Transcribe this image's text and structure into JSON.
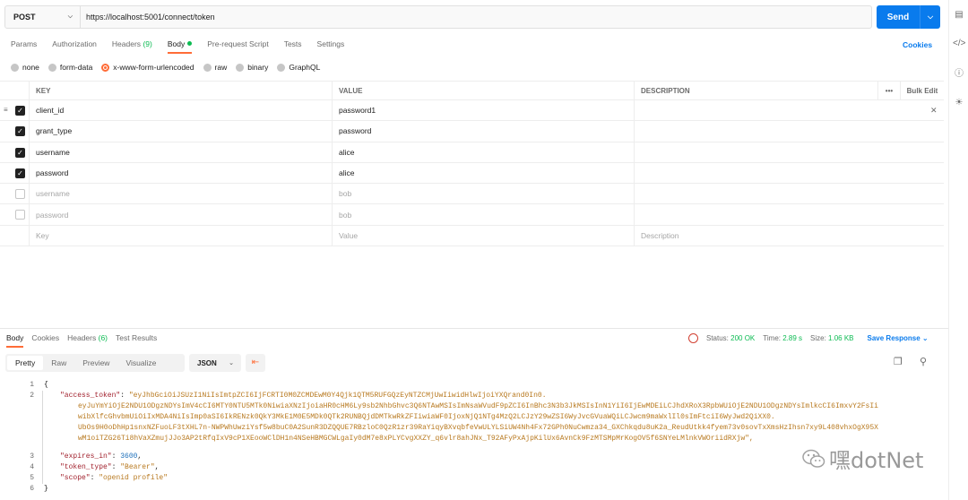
{
  "request": {
    "method": "POST",
    "url": "https://localhost:5001/connect/token",
    "send_label": "Send"
  },
  "tabs": [
    {
      "label": "Params"
    },
    {
      "label": "Authorization"
    },
    {
      "label": "Headers",
      "count": "(9)"
    },
    {
      "label": "Body",
      "active": true
    },
    {
      "label": "Pre-request Script"
    },
    {
      "label": "Tests"
    },
    {
      "label": "Settings"
    }
  ],
  "cookies_label": "Cookies",
  "body_types": [
    "none",
    "form-data",
    "x-www-form-urlencoded",
    "raw",
    "binary",
    "GraphQL"
  ],
  "selected_body_type": "x-www-form-urlencoded",
  "table": {
    "headers": {
      "key": "KEY",
      "value": "VALUE",
      "description": "DESCRIPTION",
      "more": "•••",
      "bulk": "Bulk Edit"
    },
    "rows": [
      {
        "checked": true,
        "key": "client_id",
        "value": "password1"
      },
      {
        "checked": true,
        "key": "grant_type",
        "value": "password"
      },
      {
        "checked": true,
        "key": "username",
        "value": "alice"
      },
      {
        "checked": true,
        "key": "password",
        "value": "alice"
      },
      {
        "checked": false,
        "key": "username",
        "value": "bob"
      },
      {
        "checked": false,
        "key": "password",
        "value": "bob"
      }
    ],
    "placeholder": {
      "key": "Key",
      "value": "Value",
      "description": "Description"
    }
  },
  "response": {
    "tabs": [
      {
        "label": "Body",
        "active": true
      },
      {
        "label": "Cookies"
      },
      {
        "label": "Headers",
        "count": "(6)"
      },
      {
        "label": "Test Results"
      }
    ],
    "status_label": "Status:",
    "status_value": "200 OK",
    "time_label": "Time:",
    "time_value": "2.89 s",
    "size_label": "Size:",
    "size_value": "1.06 KB",
    "save_label": "Save Response",
    "views": [
      "Pretty",
      "Raw",
      "Preview",
      "Visualize"
    ],
    "active_view": "Pretty",
    "format": "JSON",
    "line_numbers": [
      "1",
      "2",
      "",
      "",
      "",
      "",
      "3",
      "4",
      "5",
      "6"
    ],
    "json": {
      "open": "{",
      "access_token_key": "\"access_token\"",
      "token_lines": [
        "\"eyJhbGciOiJSUzI1NiIsImtpZCI6IjFCRTI0M0ZCMDEwM0Y4Qjk1QTM5RUFGQzEyNTZCMjUwIiwidHlwIjoiYXQrand0In0.",
        "eyJuYmYiOjE2NDU1ODgzNDYsImV4cCI6MTY0NTU5MTk0NiwiaXNzIjoiaHR0cHM6Ly9sb2NhbGhvc3Q6NTAwMSIsImNsaWVudF9pZCI6InBhc3N3b3JkMSIsInN1YiI6IjEwMDEiLCJhdXRoX3RpbWUiOjE2NDU1ODgzNDYsImlkcCI6ImxvY2FsIi",
        "wibXlfcGhvbmUiOiIxMDA4NiIsImp0aSI6IkRENzk0QkY3MkE1M0E5MDk0QTk2RUNBQjdDMTkwRkZFIiwiaWF0IjoxNjQ1NTg4MzQ2LCJzY29wZSI6WyJvcGVuaWQiLCJwcm9maWxlIl0sImFtciI6WyJwd2QiXX0.",
        "UbOs9H0oDhHp1snxNZFuoLF3tXHL7n-NWPWhUwziYsf5w8buC0A2SunR3DZQQUE7RBzloC0QzR1zr39RaYiqyBXvqbfeVwULYLSiUW4Nh4Fx72GPh0NuCwmza34_GXChkqdu8uK2a_ReudUtkk4fyem73v0sovTxXmsHzIhsn7xy9L408vhxOgX95X",
        "wM1oiTZG26Ti8hVaXZmujJJo3AP2tRfqIxV9cP1XEooWClDH1n4NSeHBMGCWLgaIy0dM7e8xPLYCvgXXZY_q6vlr8ahJNx_T92AFyPxAjpKilUx6AvnCk9FzMTSMpMrKogOV5f6SNYeLMlnkVWOriidRXjw\","
      ],
      "expires_key": "\"expires_in\"",
      "expires_value": "3600",
      "token_type_key": "\"token_type\"",
      "token_type_value": "\"Bearer\"",
      "scope_key": "\"scope\"",
      "scope_value": "\"openid profile\"",
      "close": "}"
    }
  },
  "watermark": "嘿dotNet"
}
